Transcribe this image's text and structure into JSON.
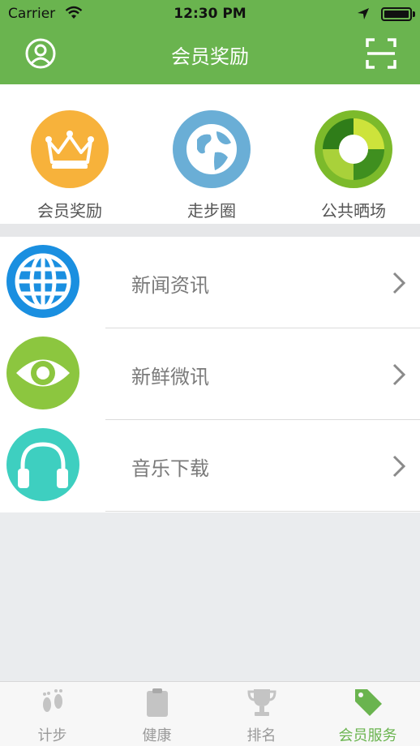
{
  "status_bar": {
    "carrier": "Carrier",
    "time": "12:30 PM",
    "wifi_icon": "wifi-icon",
    "location_icon": "location-arrow-icon",
    "battery_level": 1.0
  },
  "nav": {
    "title": "会员奖励",
    "left_icon": "user-icon",
    "right_icon": "scan-icon"
  },
  "quick_actions": [
    {
      "label": "会员奖励",
      "icon": "crown-icon",
      "color": "#f7b23b"
    },
    {
      "label": "走步圈",
      "icon": "globe-icon",
      "color": "#6aaed6"
    },
    {
      "label": "公共晒场",
      "icon": "ring-icon",
      "color": "#7cba2b"
    }
  ],
  "menu": [
    {
      "label": "新闻资讯",
      "icon": "web-globe-icon",
      "color": "#1a8fe0",
      "chevron": "chevron-right-icon"
    },
    {
      "label": "新鲜微讯",
      "icon": "eye-icon",
      "color": "#8cc63f",
      "chevron": "chevron-right-icon"
    },
    {
      "label": "音乐下载",
      "icon": "headphones-icon",
      "color": "#3ecfc0",
      "chevron": "chevron-right-icon"
    }
  ],
  "tabs": [
    {
      "label": "计步",
      "icon": "footprints-icon",
      "active": false
    },
    {
      "label": "健康",
      "icon": "clipboard-icon",
      "active": false
    },
    {
      "label": "排名",
      "icon": "trophy-icon",
      "active": false
    },
    {
      "label": "会员服务",
      "icon": "tag-icon",
      "active": true
    }
  ],
  "colors": {
    "brand_green": "#6ab44f",
    "tab_inactive": "#9a9a9a",
    "background": "#eaecee"
  }
}
